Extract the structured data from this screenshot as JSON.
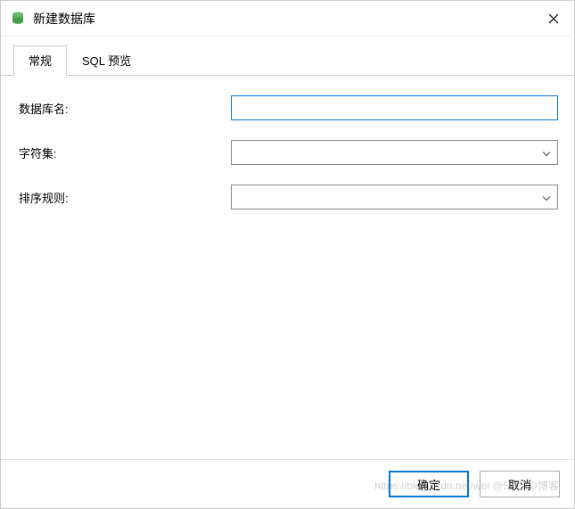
{
  "titlebar": {
    "title": "新建数据库"
  },
  "tabs": {
    "general": "常规",
    "sql_preview": "SQL 预览"
  },
  "form": {
    "db_name_label": "数据库名:",
    "db_name_value": "",
    "charset_label": "字符集:",
    "charset_value": "",
    "collation_label": "排序规则:",
    "collation_value": ""
  },
  "footer": {
    "ok": "确定",
    "cancel": "取消"
  },
  "watermark": "https://blog.csdn.net/wei @51CTO博客"
}
